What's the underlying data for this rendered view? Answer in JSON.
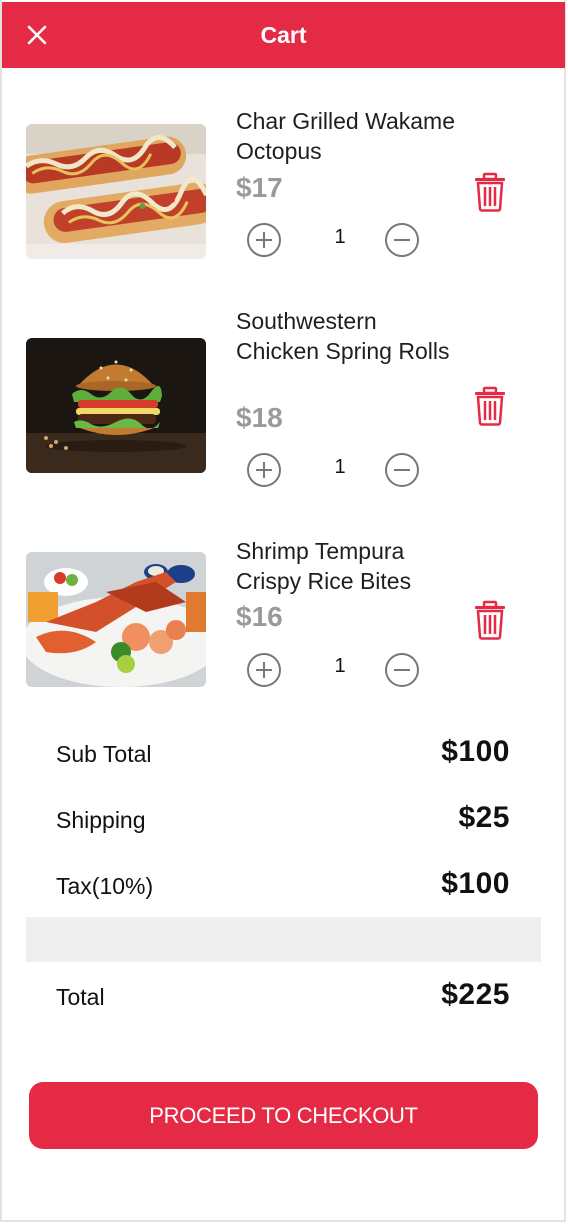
{
  "header": {
    "title": "Cart",
    "close_icon": "close-icon"
  },
  "colors": {
    "accent": "#e52a45",
    "price_gray": "#9a9a9a",
    "band_gray": "#efefef"
  },
  "items": [
    {
      "name": "Char Grilled Wakame Octopus",
      "price": "$17",
      "quantity": "1",
      "image": "hot-dogs-photo"
    },
    {
      "name": "Southwestern Chicken Spring Rolls",
      "price": "$18",
      "quantity": "1",
      "image": "burger-photo"
    },
    {
      "name": "Shrimp Tempura Crispy Rice Bites",
      "price": "$16",
      "quantity": "1",
      "image": "seafood-platter-photo"
    }
  ],
  "summary": {
    "subtotal": {
      "label": "Sub Total",
      "value": "$100"
    },
    "shipping": {
      "label": "Shipping",
      "value": "$25"
    },
    "tax": {
      "label": "Tax(10%)",
      "value": "$100"
    },
    "total": {
      "label": "Total",
      "value": "$225"
    }
  },
  "checkout": {
    "label": "PROCEED TO CHECKOUT"
  }
}
